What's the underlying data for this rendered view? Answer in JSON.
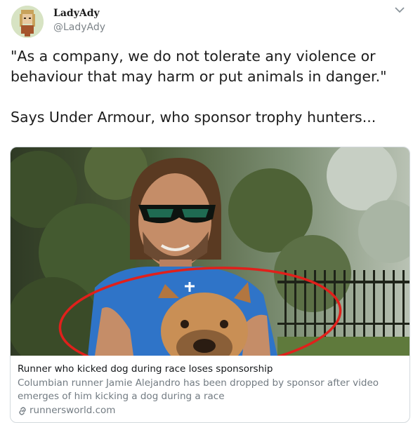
{
  "tweet": {
    "author": {
      "display_name": "LadyAdy",
      "handle": "@LadyAdy"
    },
    "text": "\"As a company, we do not tolerate any violence or behaviour that may harm or put animals in danger.\"\n\nSays Under Armour, who sponsor trophy hunters...",
    "icons": {
      "menu": "chevron-down-icon",
      "link": "link-icon"
    }
  },
  "card": {
    "image_alt": "Man with sunglasses holding a French bulldog, dog circled in red",
    "title": "Runner who kicked dog during race loses sponsorship",
    "description": "Columbian runner Jamie Alejandro has been dropped by sponsor after video emerges of him kicking a dog during a race",
    "domain": "runnersworld.com"
  },
  "colors": {
    "annotation_circle": "#e0201b",
    "shirt": "#2f74c8",
    "dog": "#c98f55"
  }
}
